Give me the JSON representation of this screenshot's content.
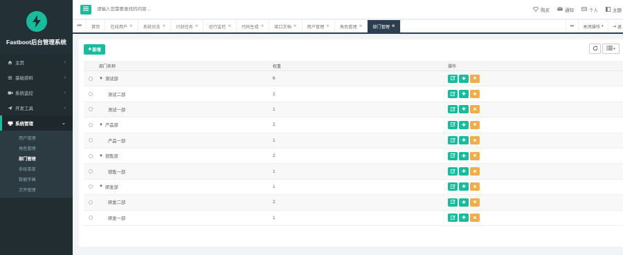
{
  "app": {
    "title": "Fastboot后台管理系统",
    "accent": "#18bc9c",
    "sidebar_bg": "#222d32",
    "header_dark": "#2c3e50"
  },
  "sidebar": {
    "items": [
      {
        "label": "主页",
        "icon": "home-icon"
      },
      {
        "label": "基础资料",
        "icon": "list-icon"
      },
      {
        "label": "系统监控",
        "icon": "video-icon"
      },
      {
        "label": "开发工具",
        "icon": "send-icon"
      },
      {
        "label": "系统管理",
        "icon": "desktop-icon"
      }
    ],
    "submenu": [
      "用户管理",
      "角色管理",
      "部门管理",
      "系统菜单",
      "数据字典",
      "文件管理"
    ]
  },
  "header": {
    "search_placeholder": "请输入您需要查找的内容 ...",
    "links": [
      {
        "label": "购买",
        "icon": "diamond-icon"
      },
      {
        "label": "通知",
        "icon": "envelope-icon"
      },
      {
        "label": "个人",
        "icon": "user-card-icon"
      },
      {
        "label": "主题",
        "icon": "theme-icon"
      }
    ]
  },
  "tabs": {
    "items": [
      "首页",
      "在线用户",
      "系统日志",
      "计划任务",
      "运行监控",
      "代码生成",
      "接口文档",
      "用户管理",
      "角色管理",
      "部门管理"
    ],
    "active": "部门管理",
    "close_ops": "关闭操作",
    "exit": "退"
  },
  "toolbar": {
    "add_label": "新增"
  },
  "table": {
    "headers": {
      "name": "部门名称",
      "weight": "权重",
      "ops": "操作"
    },
    "rows": [
      {
        "name": "测试部",
        "weight": "6",
        "level": 0
      },
      {
        "name": "测试二部",
        "weight": "2",
        "level": 1
      },
      {
        "name": "测试一部",
        "weight": "1",
        "level": 1
      },
      {
        "name": "产品部",
        "weight": "2",
        "level": 0
      },
      {
        "name": "产品一部",
        "weight": "1",
        "level": 1
      },
      {
        "name": "销售部",
        "weight": "2",
        "level": 0
      },
      {
        "name": "销售一部",
        "weight": "1",
        "level": 1
      },
      {
        "name": "研发部",
        "weight": "1",
        "level": 0
      },
      {
        "name": "研发二部",
        "weight": "2",
        "level": 1
      },
      {
        "name": "研发一部",
        "weight": "1",
        "level": 1
      }
    ]
  }
}
